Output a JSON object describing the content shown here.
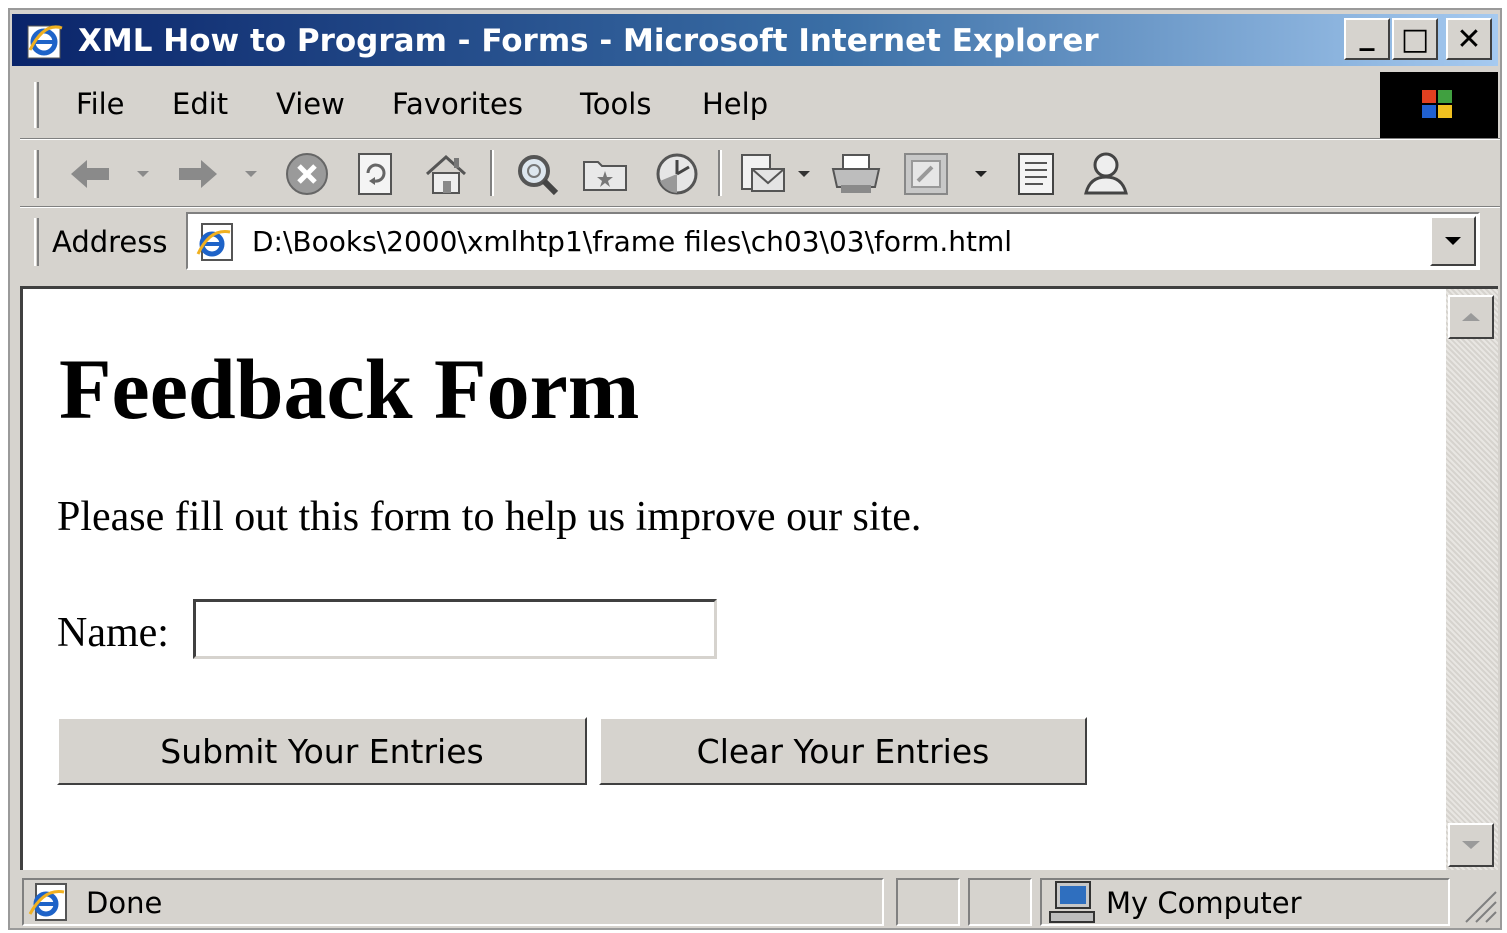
{
  "window": {
    "title": "XML How to Program - Forms - Microsoft Internet Explorer",
    "minimize_glyph": "_",
    "maximize_glyph": "□",
    "close_glyph": "✕"
  },
  "menubar": {
    "items": [
      "File",
      "Edit",
      "View",
      "Favorites",
      "Tools",
      "Help"
    ]
  },
  "toolbar": {
    "icons": [
      "back-icon",
      "forward-icon",
      "stop-icon",
      "refresh-icon",
      "home-icon",
      "search-icon",
      "favorites-icon",
      "history-icon",
      "mail-icon",
      "print-icon",
      "edit-icon",
      "discuss-icon",
      "messenger-icon"
    ]
  },
  "address": {
    "label": "Address",
    "url": "D:\\Books\\2000\\xmlhtp1\\frame files\\ch03\\03\\form.html"
  },
  "page": {
    "heading": "Feedback Form",
    "intro": "Please fill out this form to help us improve our site.",
    "name_label": "Name:",
    "name_value": "",
    "submit_label": "Submit Your Entries",
    "reset_label": "Clear Your Entries"
  },
  "statusbar": {
    "status": "Done",
    "zone": "My Computer"
  },
  "colors": {
    "chrome": "#d6d3ce",
    "title_start": "#0a246a",
    "title_end": "#a6caf0"
  }
}
